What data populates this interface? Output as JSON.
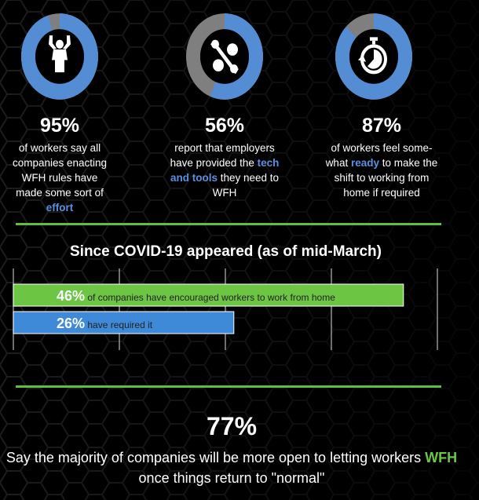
{
  "colors": {
    "blue": "#548dd4",
    "gray": "#7f7f7f",
    "green": "#6cc644",
    "bar_blue": "#3f8ad8",
    "rule": "#5fbf3c"
  },
  "stats": [
    {
      "pct": "95%",
      "value": 95,
      "icon": "flexing-person-icon",
      "pre": "of workers say all companies enacting WFH rules have made some sort of ",
      "highlight": "effort",
      "post": ""
    },
    {
      "pct": "56%",
      "value": 56,
      "icon": "wrench-gear-icon",
      "pre": "report that employers have provided the ",
      "highlight": "tech and tools",
      "post": " they need to WFH"
    },
    {
      "pct": "87%",
      "value": 87,
      "icon": "stopwatch-icon",
      "pre": "of workers feel some-what ",
      "highlight": "ready",
      "post": " to make the shift to working from home if required"
    }
  ],
  "chart_data": {
    "type": "bar",
    "orientation": "horizontal",
    "title": "Since COVID-19 appeared (as of mid-March)",
    "xlim": [
      0,
      50
    ],
    "grid": true,
    "categories": [
      "of companies have encouraged workers to work from home",
      "have required it"
    ],
    "values": [
      46,
      26
    ],
    "value_labels": [
      "46%",
      "26%"
    ]
  },
  "footer": {
    "pct": "77%",
    "pre": "Say the majority of companies will be more open to letting workers ",
    "highlight": "WFH",
    "post": " once things return to \"normal\""
  }
}
